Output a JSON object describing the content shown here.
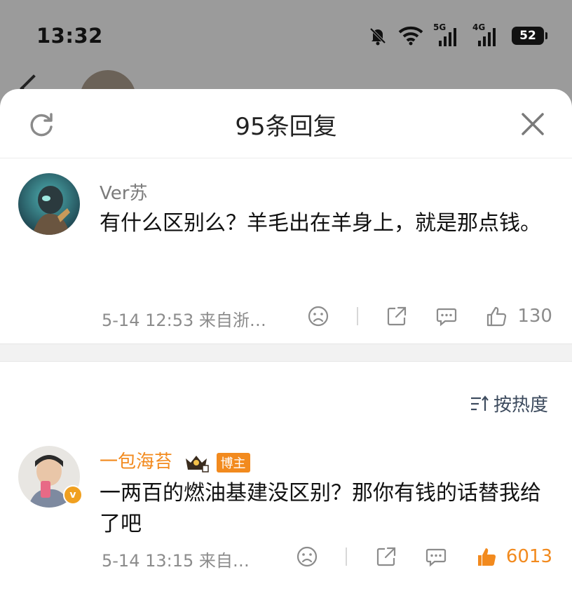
{
  "status_bar": {
    "time": "13:32",
    "network_1": "5G",
    "network_2": "4G",
    "battery": "52"
  },
  "sheet": {
    "title": "95条回复"
  },
  "root_comment": {
    "username": "Ver苏",
    "text": "有什么区别么？羊毛出在羊身上，就是那点钱。",
    "meta": "5-14 12:53  来自浙…",
    "likes": "130"
  },
  "sort": {
    "label": "按热度"
  },
  "reply": {
    "username": "一包海苔",
    "badge": "博主",
    "verified_mark": "v",
    "text": "一两百的燃油基建没区别？那你有钱的话替我给了吧",
    "meta": "5-14 13:15  来自…",
    "likes": "6013"
  },
  "colors": {
    "accent_orange": "#f28a1e",
    "meta_gray": "#8c8c8c",
    "sort_blue": "#3d4b5e"
  }
}
